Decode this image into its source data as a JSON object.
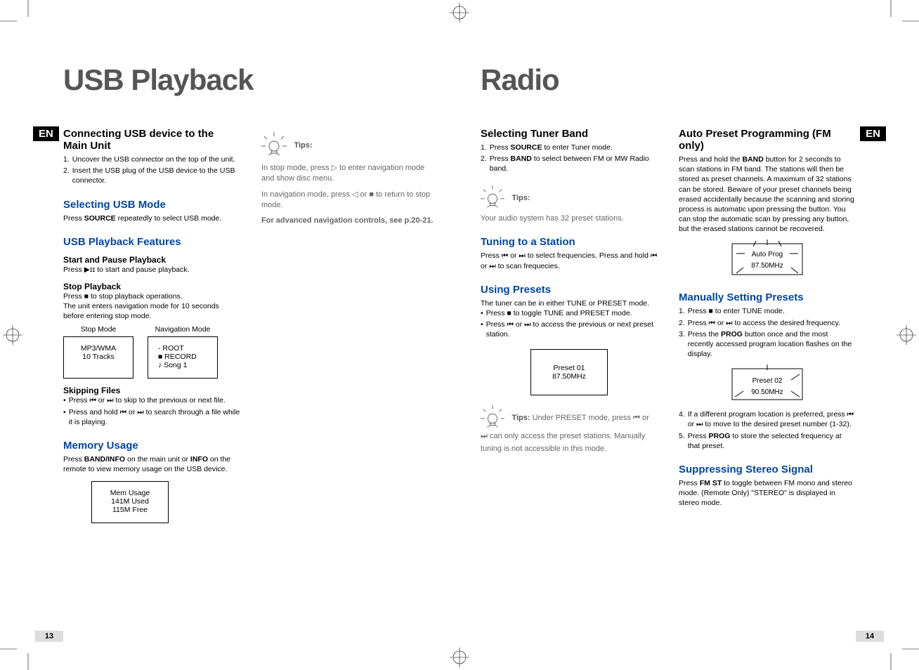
{
  "left": {
    "title": "USB Playback",
    "en": "EN",
    "sec_connecting": {
      "heading": "Connecting USB device to the Main Unit",
      "i1_num": "1.",
      "i1": "Uncover the USB connector on the top of the unit.",
      "i2_num": "2.",
      "i2": "Insert the USB plug of the USB device to the USB connector."
    },
    "sec_select_mode": {
      "heading": "Selecting USB Mode",
      "body_pre": "Press ",
      "body_btn": "SOURCE",
      "body_post": " repeatedly to select USB mode."
    },
    "sec_features": {
      "heading": "USB Playback Features",
      "start_pause_h": "Start and Pause Playback",
      "start_pause_b": "Press ▶ɪɪ to start and pause playback.",
      "stop_h": "Stop Playback",
      "stop_b1": "Press ■  to stop playback operations.",
      "stop_b2": "The unit enters navigation mode for 10 seconds before entering stop mode.",
      "mode_stop_label": "Stop Mode",
      "mode_nav_label": "Navigation Mode",
      "box_stop_l1": "MP3/WMA",
      "box_stop_l2": "10 Tracks",
      "box_nav_l1": "- ROOT",
      "box_nav_l2": "■  RECORD",
      "box_nav_l3": "♪   Song 1"
    },
    "sec_skip": {
      "heading": "Skipping Files",
      "b1": "Press  ⏮ or ⏭ to skip to the previous or next file.",
      "b2": "Press and hold  ⏮ or ⏭ to search through a file while it is playing."
    },
    "sec_memory": {
      "heading": "Memory Usage",
      "body_pre": "Press ",
      "body_b1": "BAND/INFO",
      "body_mid": " on the main unit or ",
      "body_b2": "INFO",
      "body_post": " on the remote to view memory usage on the USB device.",
      "box_l1": "Mem Usage",
      "box_l2": "141M Used",
      "box_l3": "115M Free"
    },
    "tips": {
      "label": "Tips:",
      "p1": "In stop mode, press ▷ to enter navigation mode and show disc menu.",
      "p2": "In navigation mode, press ◁ or ■ to return to stop mode.",
      "p3": "For advanced navigation controls, see p.20-21."
    },
    "page_num": "13"
  },
  "right": {
    "title": "Radio",
    "en": "EN",
    "sec_band": {
      "heading": "Selecting Tuner Band",
      "i1_num": "1.",
      "i1_pre": "Press ",
      "i1_b": "SOURCE",
      "i1_post": " to enter Tuner mode.",
      "i2_num": "2.",
      "i2_pre": "Press ",
      "i2_b": "BAND",
      "i2_post": " to select between FM or MW Radio band."
    },
    "tips1": {
      "label": "Tips:",
      "body": "Your audio system has 32 preset stations."
    },
    "sec_tuning": {
      "heading": "Tuning to a Station",
      "body": "Press ⏮ or ⏭ to select frequencies. Press and hold ⏮ or ⏭ to scan frequecies."
    },
    "sec_presets": {
      "heading": "Using Presets",
      "intro": "The tuner can be in either TUNE or PRESET mode.",
      "b1": "Press ■  to toggle TUNE and PRESET mode.",
      "b2": "Press ⏮ or ⏭ to access the previous or next preset station.",
      "box_l1": "Preset 01",
      "box_l2": "87.50MHz"
    },
    "tips2": {
      "label": "Tips:",
      "body": " Under PRESET mode, press ⏮ or  ⏭  can only access the preset stations. Manually tuning is not accessible in this mode."
    },
    "sec_auto": {
      "heading": "Auto Preset Programming (FM only)",
      "body_pre": "Press and hold the ",
      "body_b": "BAND",
      "body_post": " button for 2 seconds to scan stations in FM band. The stations will then be stored as preset channels. A maximum of 32 stations can be stored. Beware of your preset channels being erased accidentally because the scanning and storing process is automatic upon pressing the button. You can stop the automatic scan by pressing any button, but the erased stations cannot be recovered.",
      "disp_l1": "Auto Prog",
      "disp_l2": "87.50MHz"
    },
    "sec_manual": {
      "heading": "Manually Setting Presets",
      "i1_num": "1.",
      "i1": "Press  ■  to enter TUNE mode.",
      "i2_num": "2.",
      "i2": "Press  ⏮ or ⏭ to access the desired frequency.",
      "i3_num": "3.",
      "i3_pre": "Press the ",
      "i3_b": "PROG",
      "i3_post": " button once and the most recently accessed program location flashes on the display.",
      "disp_l1": "Preset 02",
      "disp_l2": "90.50MHz",
      "i4_num": "4.",
      "i4": "If a different program location is preferred, press  ⏮ or ⏭  to move to the desired preset number (1-32).",
      "i5_num": "5.",
      "i5_pre": "Press ",
      "i5_b": "PROG",
      "i5_post": " to store the selected frequency at that preset."
    },
    "sec_stereo": {
      "heading": "Suppressing Stereo Signal",
      "body_pre": "Press ",
      "body_b": "FM ST",
      "body_post": " to toggle between FM mono and stereo mode. (Remote Only) \"STEREO\" is displayed in stereo mode."
    },
    "page_num": "14"
  }
}
